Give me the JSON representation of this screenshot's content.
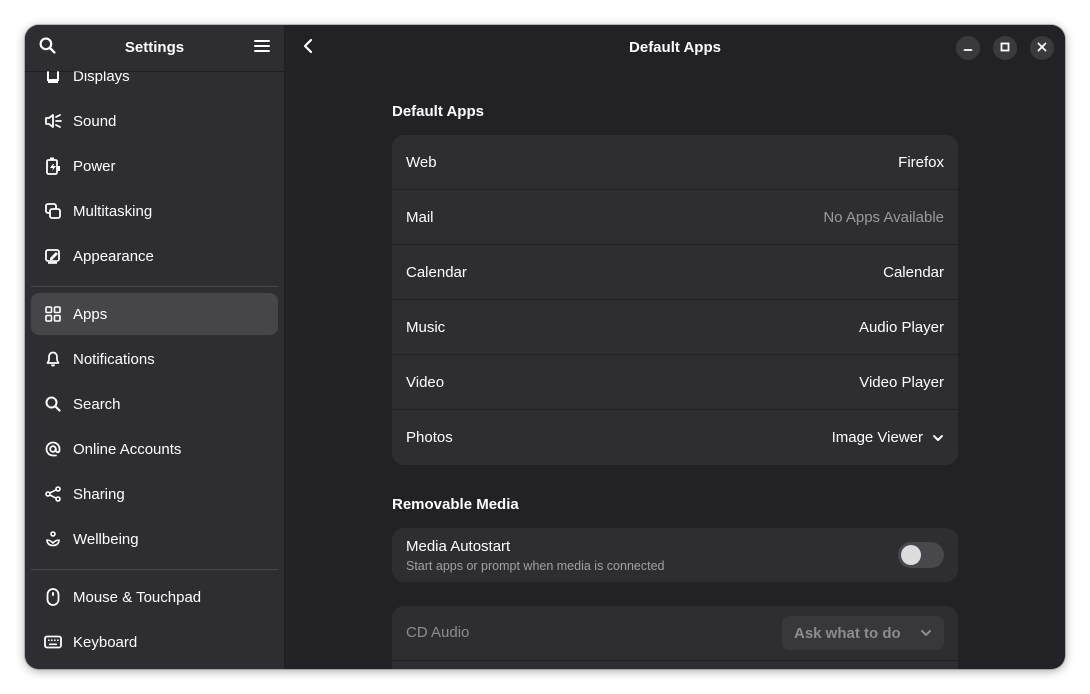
{
  "sidebar": {
    "title": "Settings",
    "items": [
      {
        "label": "Displays",
        "icon": "display-icon"
      },
      {
        "label": "Sound",
        "icon": "speaker-icon"
      },
      {
        "label": "Power",
        "icon": "power-icon"
      },
      {
        "label": "Multitasking",
        "icon": "multitasking-icon"
      },
      {
        "label": "Appearance",
        "icon": "appearance-icon"
      },
      {
        "label": "Apps",
        "icon": "apps-grid-icon",
        "active": true
      },
      {
        "label": "Notifications",
        "icon": "bell-icon"
      },
      {
        "label": "Search",
        "icon": "search-icon"
      },
      {
        "label": "Online Accounts",
        "icon": "at-sign-icon"
      },
      {
        "label": "Sharing",
        "icon": "share-icon"
      },
      {
        "label": "Wellbeing",
        "icon": "wellbeing-icon"
      },
      {
        "label": "Mouse & Touchpad",
        "icon": "mouse-icon"
      },
      {
        "label": "Keyboard",
        "icon": "keyboard-icon"
      }
    ]
  },
  "main": {
    "title": "Default Apps",
    "default_apps": {
      "heading": "Default Apps",
      "rows": [
        {
          "label": "Web",
          "value": "Firefox"
        },
        {
          "label": "Mail",
          "value": "No Apps Available"
        },
        {
          "label": "Calendar",
          "value": "Calendar"
        },
        {
          "label": "Music",
          "value": "Audio Player"
        },
        {
          "label": "Video",
          "value": "Video Player"
        },
        {
          "label": "Photos",
          "value": "Image Viewer"
        }
      ]
    },
    "removable_media": {
      "heading": "Removable Media",
      "autostart_title": "Media Autostart",
      "autostart_subtitle": "Start apps or prompt when media is connected",
      "autostart_enabled": false,
      "cd_audio_label": "CD Audio",
      "cd_audio_value": "Ask what to do"
    }
  },
  "colors": {
    "window_bg": "#222226",
    "sidebar_bg": "#2e2e32",
    "card_bg": "#2e2e32",
    "active_item": "#45454a"
  }
}
